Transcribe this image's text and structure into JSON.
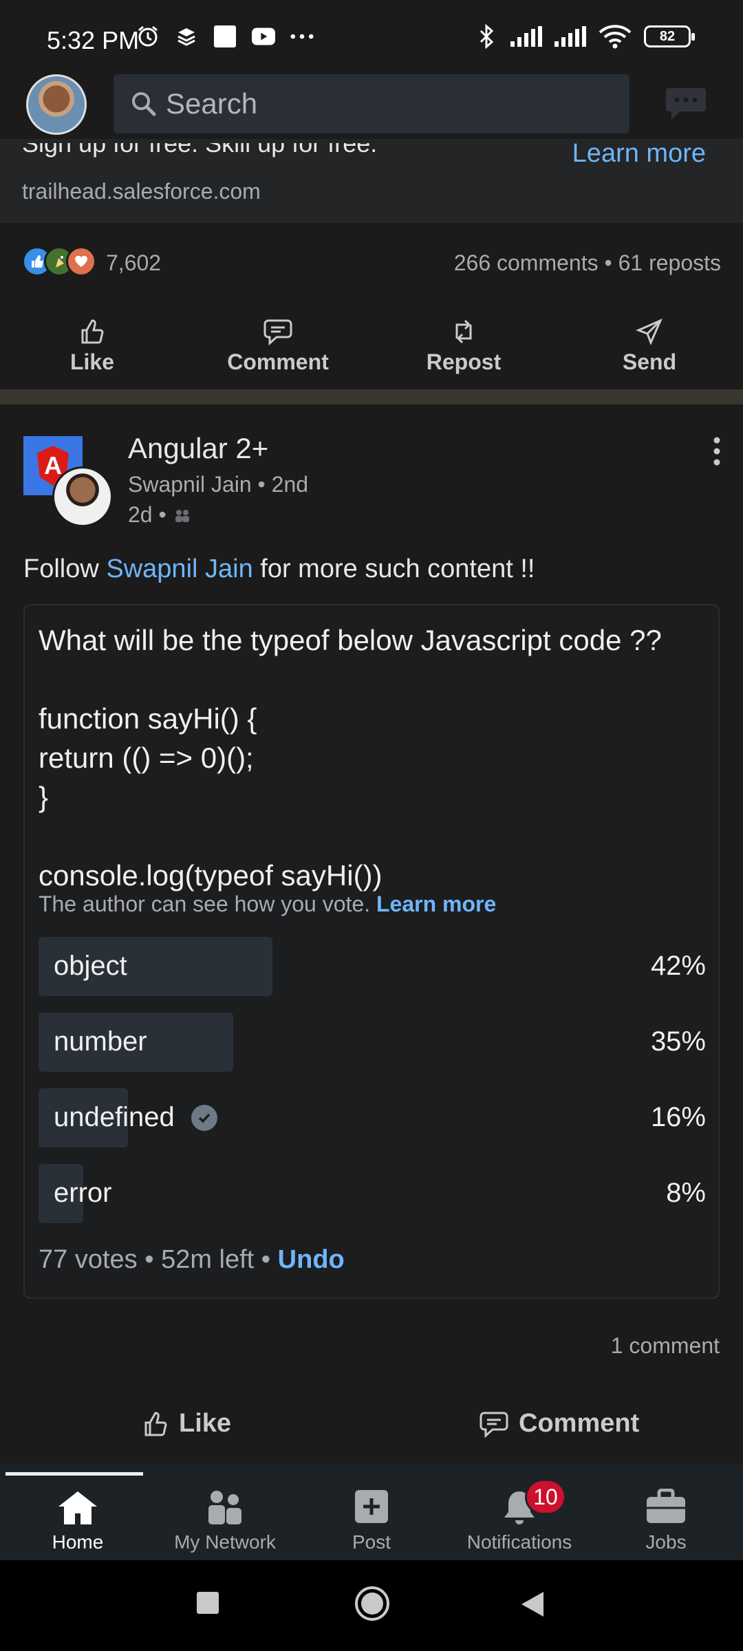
{
  "status_bar": {
    "time": "5:32 PM",
    "left_icons": [
      "alarm-icon",
      "layers-icon",
      "square-icon",
      "youtube-icon",
      "more-dots-icon"
    ],
    "right_icons": [
      "bluetooth-icon",
      "signal-icon",
      "signal-icon",
      "wifi-icon"
    ],
    "battery": "82"
  },
  "top_bar": {
    "search_placeholder": "Search"
  },
  "previous_post": {
    "cut_text": "Sign up for free. Skill up for free.",
    "learn_more": "Learn more",
    "domain": "trailhead.salesforce.com",
    "reaction_count": "7,602",
    "meta": "266 comments • 61 reposts",
    "actions": [
      "Like",
      "Comment",
      "Repost",
      "Send"
    ]
  },
  "post": {
    "page_name": "Angular 2+",
    "author_line": "Swapnil Jain • 2nd",
    "time": "2d •",
    "logo_letter": "A",
    "text_before": "Follow ",
    "mention": "Swapnil Jain",
    "text_after": " for more such content !!",
    "poll": {
      "question": "What will be the typeof below Javascript code ??\n\nfunction sayHi() {\nreturn (() => 0)();\n}\n\nconsole.log(typeof sayHi())",
      "note": "The author can see how you vote.",
      "note_link": "Learn more",
      "options": [
        {
          "label": "object",
          "percent": "42%",
          "value": 42,
          "selected": false
        },
        {
          "label": "number",
          "percent": "35%",
          "value": 35,
          "selected": false
        },
        {
          "label": "undefined",
          "percent": "16%",
          "value": 16,
          "selected": true
        },
        {
          "label": "error",
          "percent": "8%",
          "value": 8,
          "selected": false
        }
      ],
      "footer": "77 votes • 52m left •",
      "undo": "Undo"
    },
    "comment_count": "1 comment",
    "actions": {
      "like": "Like",
      "comment": "Comment"
    }
  },
  "bottom_nav": {
    "items": [
      {
        "label": "Home",
        "icon": "home-icon"
      },
      {
        "label": "My Network",
        "icon": "network-icon"
      },
      {
        "label": "Post",
        "icon": "post-icon"
      },
      {
        "label": "Notifications",
        "icon": "bell-icon"
      },
      {
        "label": "Jobs",
        "icon": "briefcase-icon"
      }
    ],
    "notifications_badge": "10",
    "active": "Home"
  },
  "colors": {
    "background": "#1b1b1b",
    "link": "#70b5f9",
    "poll_fill": "#293038",
    "badge": "#cb112d"
  }
}
